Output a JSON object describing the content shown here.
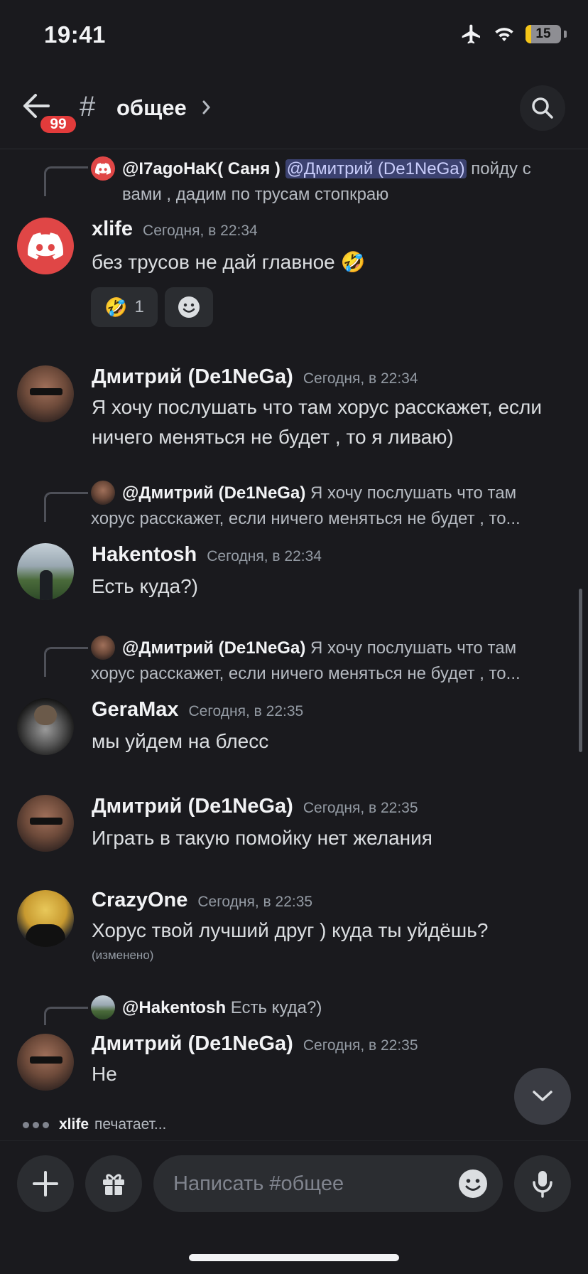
{
  "status_bar": {
    "time": "19:41",
    "battery": "15"
  },
  "header": {
    "badge_count": "99",
    "hash": "#",
    "channel": "общее"
  },
  "messages": [
    {
      "reply": {
        "user": "@I7agoHaK( Саня )",
        "mention": "@Дмитрий (De1NeGa)",
        "text_after": " пойду с вами , дадим по трусам стопкраю"
      },
      "user": "xlife",
      "time": "Сегодня, в 22:34",
      "text": "без трусов не дай главное 🤣",
      "reactions": [
        {
          "emoji": "🤣",
          "count": "1"
        }
      ]
    },
    {
      "user": "Дмитрий (De1NeGa)",
      "time": "Сегодня, в 22:34",
      "text": "Я хочу послушать что там хорус расскажет, если ничего меняться не будет , то я ливаю)"
    },
    {
      "reply": {
        "user": "@Дмитрий (De1NeGa)",
        "text_after": " Я хочу послушать что там",
        "line2": "хорус расскажет, если ничего меняться не будет , то..."
      },
      "user": "Hakentosh",
      "time": "Сегодня, в 22:34",
      "text": "Есть куда?)"
    },
    {
      "reply": {
        "user": "@Дмитрий (De1NeGa)",
        "text_after": " Я хочу послушать что там",
        "line2": "хорус расскажет, если ничего меняться не будет , то..."
      },
      "user": "GeraMax",
      "time": "Сегодня, в 22:35",
      "text": "мы уйдем на блесс"
    },
    {
      "user": "Дмитрий (De1NeGa)",
      "time": "Сегодня, в 22:35",
      "text": "Играть в такую помойку нет желания"
    },
    {
      "user": "CrazyOne",
      "time": "Сегодня, в 22:35",
      "text": "Хорус твой лучший друг ) куда ты уйдёшь?",
      "edited": "(изменено)"
    },
    {
      "reply": {
        "user": "@Hakentosh",
        "text_after": " Есть куда?)"
      },
      "user": "Дмитрий (De1NeGa)",
      "time": "Сегодня, в 22:35",
      "text": "Не"
    }
  ],
  "typing": {
    "user": "xlife",
    "suffix": "печатает..."
  },
  "composer": {
    "placeholder": "Написать #общее"
  },
  "colors": {
    "background": "#1a1a1e",
    "accent_red": "#e23b3b",
    "discord_red_avatar": "#e04646",
    "mention_bg": "#3c4270"
  },
  "icons": [
    "back-arrow-icon",
    "search-icon",
    "chevron-right-icon",
    "smile-icon",
    "plus-icon",
    "gift-icon",
    "mic-icon",
    "chevron-down-icon",
    "airplane-icon",
    "wifi-icon",
    "battery-icon",
    "discord-logo-icon"
  ]
}
